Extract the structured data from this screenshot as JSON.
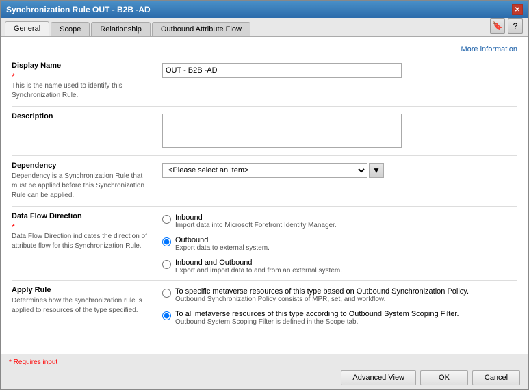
{
  "window": {
    "title": "Synchronization Rule OUT - B2B -AD",
    "close_label": "✕"
  },
  "tabs": [
    {
      "label": "General",
      "active": true
    },
    {
      "label": "Scope",
      "active": false
    },
    {
      "label": "Relationship",
      "active": false
    },
    {
      "label": "Outbound Attribute Flow",
      "active": false
    }
  ],
  "tab_actions": {
    "bookmark_icon": "🔖",
    "help_icon": "?"
  },
  "more_info": "More information",
  "form": {
    "display_name": {
      "label": "Display Name",
      "required_star": "*",
      "desc": "This is the name used to identify this Synchronization Rule.",
      "value": "OUT - B2B -AD"
    },
    "description": {
      "label": "Description",
      "value": ""
    },
    "dependency": {
      "label": "Dependency",
      "desc": "Dependency is a Synchronization Rule that must be applied before this Synchronization Rule can be applied.",
      "placeholder": "<Please select an item>",
      "dropdown_arrow": "▼"
    },
    "data_flow_direction": {
      "label": "Data Flow Direction",
      "required_star": "*",
      "desc": "Data Flow Direction indicates the direction of attribute flow for this Synchronization Rule.",
      "options": [
        {
          "value": "inbound",
          "label": "Inbound",
          "sublabel": "Import data into Microsoft Forefront Identity Manager.",
          "checked": false
        },
        {
          "value": "outbound",
          "label": "Outbound",
          "sublabel": "Export data to external system.",
          "checked": true
        },
        {
          "value": "inbound_outbound",
          "label": "Inbound and Outbound",
          "sublabel": "Export and import data to and from an external system.",
          "checked": false
        }
      ]
    },
    "apply_rule": {
      "label": "Apply Rule",
      "desc": "Determines how the synchronization rule is applied to resources of the type specified.",
      "options": [
        {
          "value": "specific",
          "label": "To specific metaverse resources of this type based on Outbound Synchronization Policy.",
          "sublabel": "Outbound Synchronization Policy consists of MPR, set, and workflow.",
          "checked": false
        },
        {
          "value": "all",
          "label": "To all metaverse resources of this type according to Outbound System Scoping Filter.",
          "sublabel": "Outbound System Scoping Filter is defined in the Scope tab.",
          "checked": true
        }
      ]
    }
  },
  "footer": {
    "requires_input": "* Requires input",
    "buttons": {
      "advanced_view": "Advanced View",
      "ok": "OK",
      "cancel": "Cancel"
    }
  }
}
